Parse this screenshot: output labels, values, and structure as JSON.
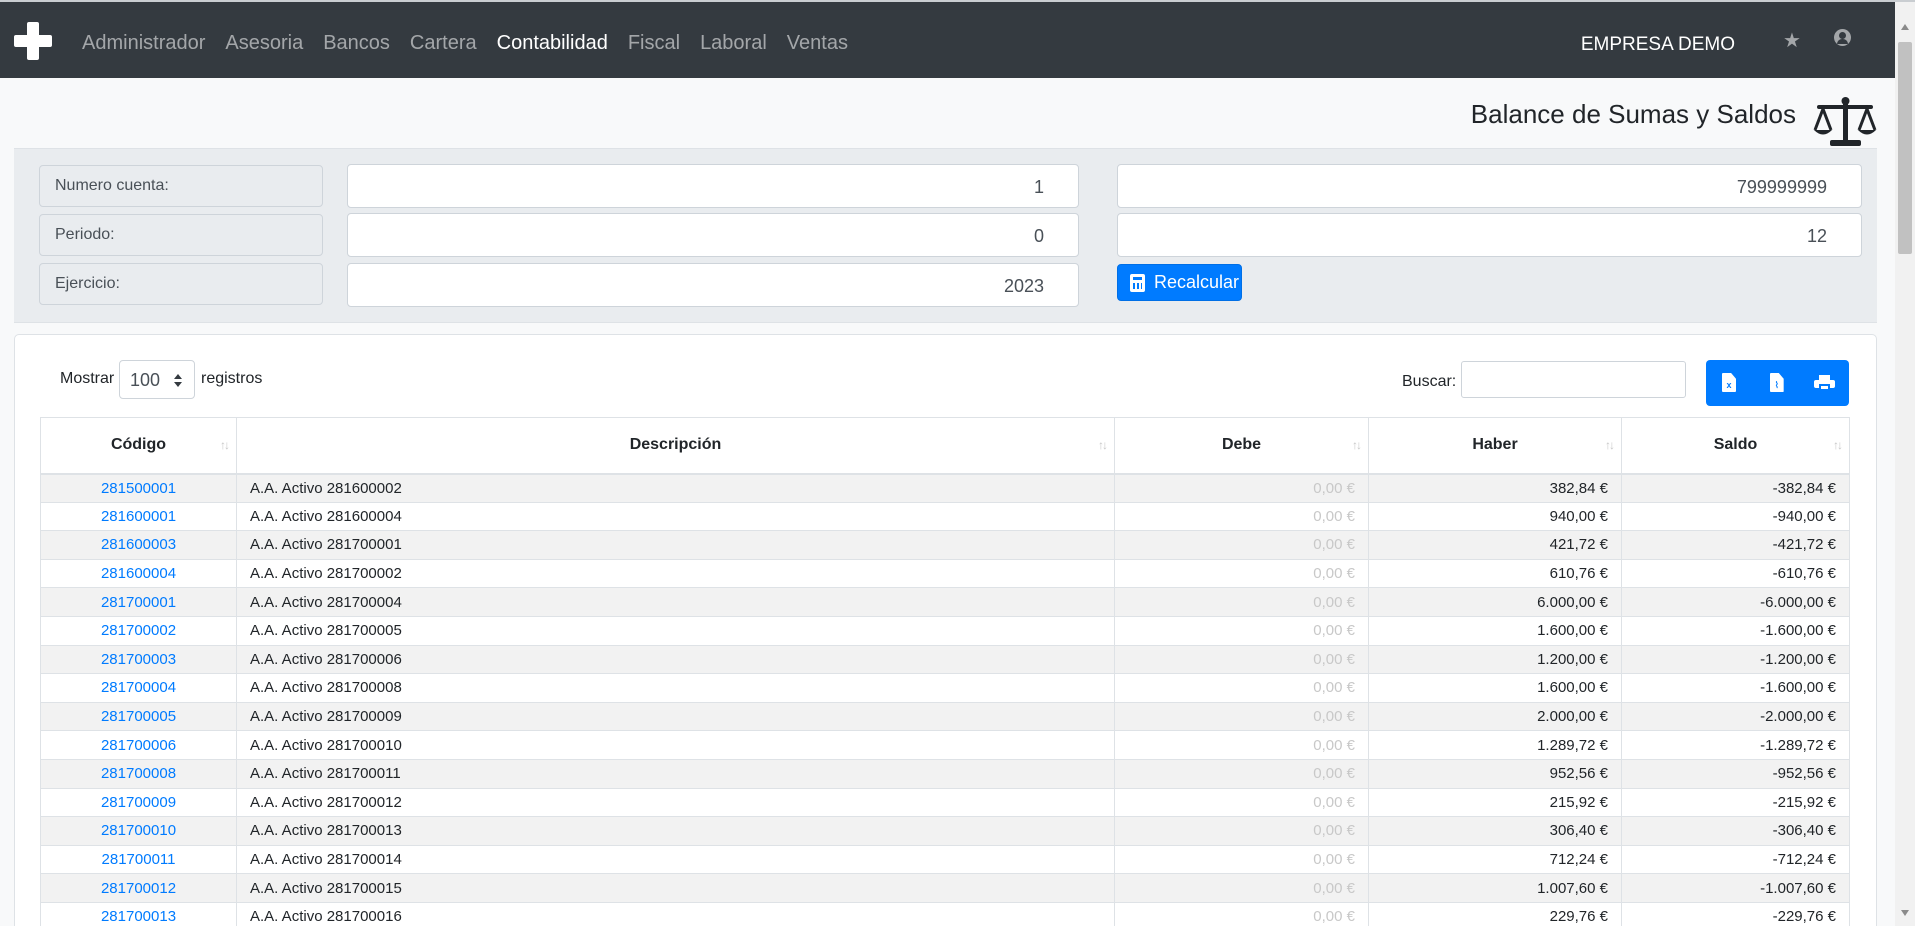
{
  "nav": {
    "menu": [
      {
        "label": "Administrador",
        "active": false
      },
      {
        "label": "Asesoria",
        "active": false
      },
      {
        "label": "Bancos",
        "active": false
      },
      {
        "label": "Cartera",
        "active": false
      },
      {
        "label": "Contabilidad",
        "active": true
      },
      {
        "label": "Fiscal",
        "active": false
      },
      {
        "label": "Laboral",
        "active": false
      },
      {
        "label": "Ventas",
        "active": false
      }
    ],
    "company": "EMPRESA DEMO"
  },
  "page": {
    "title": "Balance de Sumas y Saldos"
  },
  "filters": {
    "account_label": "Numero cuenta:",
    "account_from": "1",
    "account_to": "799999999",
    "period_label": "Periodo:",
    "period_from": "0",
    "period_to": "12",
    "year_label": "Ejercicio:",
    "year": "2023",
    "recalc_label": "Recalcular"
  },
  "table_controls": {
    "show_label": "Mostrar",
    "page_length": "100",
    "records_label": "registros",
    "search_label": "Buscar:",
    "search_value": ""
  },
  "table": {
    "columns": [
      "Código",
      "Descripción",
      "Debe",
      "Haber",
      "Saldo"
    ],
    "rows": [
      [
        "281500001",
        "A.A. Activo 281600002",
        "0,00 €",
        "382,84 €",
        "-382,84 €"
      ],
      [
        "281600001",
        "A.A. Activo 281600004",
        "0,00 €",
        "940,00 €",
        "-940,00 €"
      ],
      [
        "281600003",
        "A.A. Activo 281700001",
        "0,00 €",
        "421,72 €",
        "-421,72 €"
      ],
      [
        "281600004",
        "A.A. Activo 281700002",
        "0,00 €",
        "610,76 €",
        "-610,76 €"
      ],
      [
        "281700001",
        "A.A. Activo 281700004",
        "0,00 €",
        "6.000,00 €",
        "-6.000,00 €"
      ],
      [
        "281700002",
        "A.A. Activo 281700005",
        "0,00 €",
        "1.600,00 €",
        "-1.600,00 €"
      ],
      [
        "281700003",
        "A.A. Activo 281700006",
        "0,00 €",
        "1.200,00 €",
        "-1.200,00 €"
      ],
      [
        "281700004",
        "A.A. Activo 281700008",
        "0,00 €",
        "1.600,00 €",
        "-1.600,00 €"
      ],
      [
        "281700005",
        "A.A. Activo 281700009",
        "0,00 €",
        "2.000,00 €",
        "-2.000,00 €"
      ],
      [
        "281700006",
        "A.A. Activo 281700010",
        "0,00 €",
        "1.289,72 €",
        "-1.289,72 €"
      ],
      [
        "281700008",
        "A.A. Activo 281700011",
        "0,00 €",
        "952,56 €",
        "-952,56 €"
      ],
      [
        "281700009",
        "A.A. Activo 281700012",
        "0,00 €",
        "215,92 €",
        "-215,92 €"
      ],
      [
        "281700010",
        "A.A. Activo 281700013",
        "0,00 €",
        "306,40 €",
        "-306,40 €"
      ],
      [
        "281700011",
        "A.A. Activo 281700014",
        "0,00 €",
        "712,24 €",
        "-712,24 €"
      ],
      [
        "281700012",
        "A.A. Activo 281700015",
        "0,00 €",
        "1.007,60 €",
        "-1.007,60 €"
      ],
      [
        "281700013",
        "A.A. Activo 281700016",
        "0,00 €",
        "229,76 €",
        "-229,76 €"
      ]
    ]
  },
  "icons": {
    "brand": "plus-icon",
    "favorite": "star-icon",
    "user": "user-circle-icon",
    "page": "balance-scale-icon",
    "recalc": "calculator-icon",
    "export": [
      "file-excel-icon",
      "file-pdf-icon",
      "print-icon"
    ],
    "sort": "sort-icon"
  },
  "colors": {
    "navbar": "#343a40",
    "accent": "#007bff",
    "muted": "#c8c8c8"
  }
}
